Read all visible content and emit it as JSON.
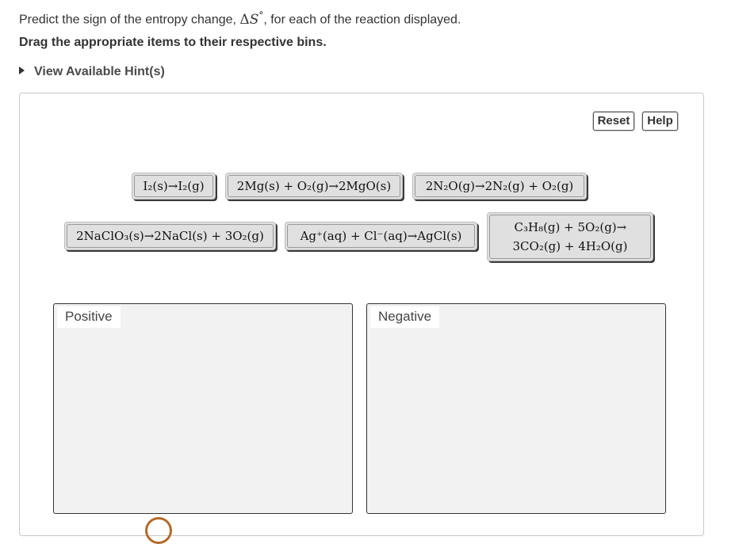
{
  "question": {
    "before": "Predict the sign of the entropy change, ",
    "symbol_delta": "Δ",
    "symbol_s": "S",
    "symbol_degree": "°",
    "after": ", for each of the reaction displayed."
  },
  "instruction": "Drag the appropriate items to their respective bins.",
  "hint_label": "View Available Hint(s)",
  "toolbar": {
    "reset_label": "Reset",
    "help_label": "Help"
  },
  "items": [
    {
      "text": "I₂(s)→I₂(g)"
    },
    {
      "text": "2Mg(s) + O₂(g)→2MgO(s)"
    },
    {
      "text": "2N₂O(g)→2N₂(g) + O₂(g)"
    },
    {
      "text": "2NaClO₃(s)→2NaCl(s) + 3O₂(g)"
    },
    {
      "text": "Ag⁺(aq) + Cl⁻(aq)→AgCl(s)"
    },
    {
      "line1": "C₃H₈(g) + 5O₂(g)→",
      "line2": "3CO₂(g) + 4H₂O(g)"
    }
  ],
  "bins": {
    "positive_label": "Positive",
    "negative_label": "Negative"
  },
  "icons": {
    "hint_toggle": "triangle-right-icon",
    "logo": "circle-logo-icon"
  },
  "colors": {
    "tile_bg": "#e0e0e0",
    "bin_bg": "#f2f2f2",
    "logo": "#b36a2a"
  }
}
